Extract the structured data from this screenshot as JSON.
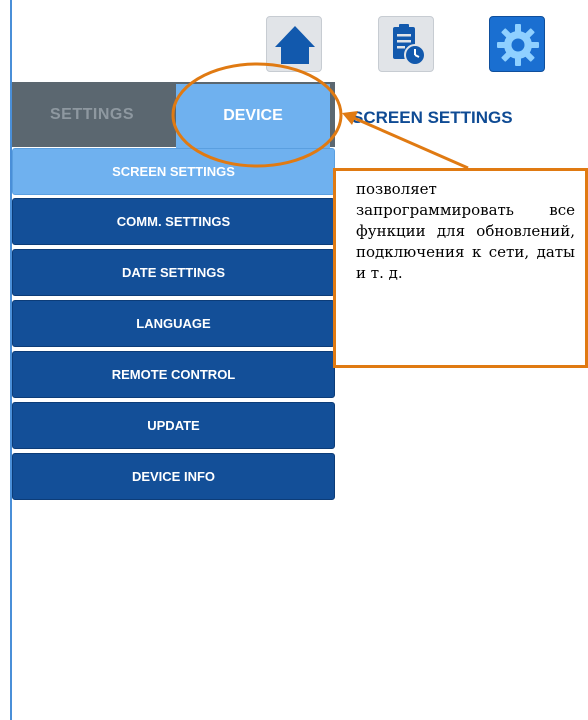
{
  "toolbar": {
    "icons": [
      "home-icon",
      "clipboard-clock-icon",
      "gear-icon"
    ],
    "accent": "#1a6fd1"
  },
  "tabs": {
    "settings_label": "SETTINGS",
    "device_label": "DEVICE"
  },
  "content": {
    "title": "SCREEN SETTINGS"
  },
  "menu": {
    "items": [
      "SCREEN SETTINGS",
      "COMM. SETTINGS",
      "DATE SETTINGS",
      "LANGUAGE",
      "REMOTE CONTROL",
      "UPDATE",
      "DEVICE INFO"
    ]
  },
  "annotation": {
    "text": "позволяет запрограммировать все функции для обновлений, подключения к сети, даты и т. д.",
    "color": "#e07a12"
  }
}
